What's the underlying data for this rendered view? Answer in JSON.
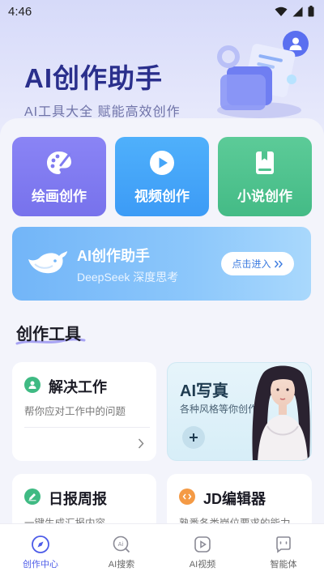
{
  "status_bar": {
    "time": "4:46"
  },
  "hero": {
    "title": "AI创作助手",
    "subtitle": "AI工具大全  赋能高效创作"
  },
  "quick_actions": [
    {
      "label": "绘画创作",
      "icon": "palette-icon",
      "color": "#7f7bf1"
    },
    {
      "label": "视频创作",
      "icon": "play-icon",
      "color": "#45a5f8"
    },
    {
      "label": "小说创作",
      "icon": "book-icon",
      "color": "#50c38f"
    }
  ],
  "ai_banner": {
    "title": "AI创作助手",
    "subtitle": "DeepSeek 深度思考",
    "button_label": "点击进入"
  },
  "section": {
    "title": "创作工具"
  },
  "tools": {
    "solve": {
      "title": "解决工作",
      "desc": "帮你应对工作中的问题"
    },
    "photo": {
      "title": "AI写真",
      "desc": "各种风格等你创作"
    },
    "daily": {
      "title": "日报周报",
      "desc": "一键生成汇报内容"
    },
    "jd": {
      "title": "JD编辑器",
      "desc": "熟悉各类岗位要求的能力"
    }
  },
  "tab_bar": [
    {
      "label": "创作中心",
      "icon": "compass-icon",
      "active": true
    },
    {
      "label": "AI搜索",
      "icon": "ai-search-icon",
      "active": false
    },
    {
      "label": "AI视频",
      "icon": "ai-video-icon",
      "active": false
    },
    {
      "label": "智能体",
      "icon": "agent-icon",
      "active": false
    }
  ],
  "colors": {
    "accent": "#4d5ce8",
    "hero_title": "#2a2f8c",
    "banner": "#72b5f8"
  }
}
